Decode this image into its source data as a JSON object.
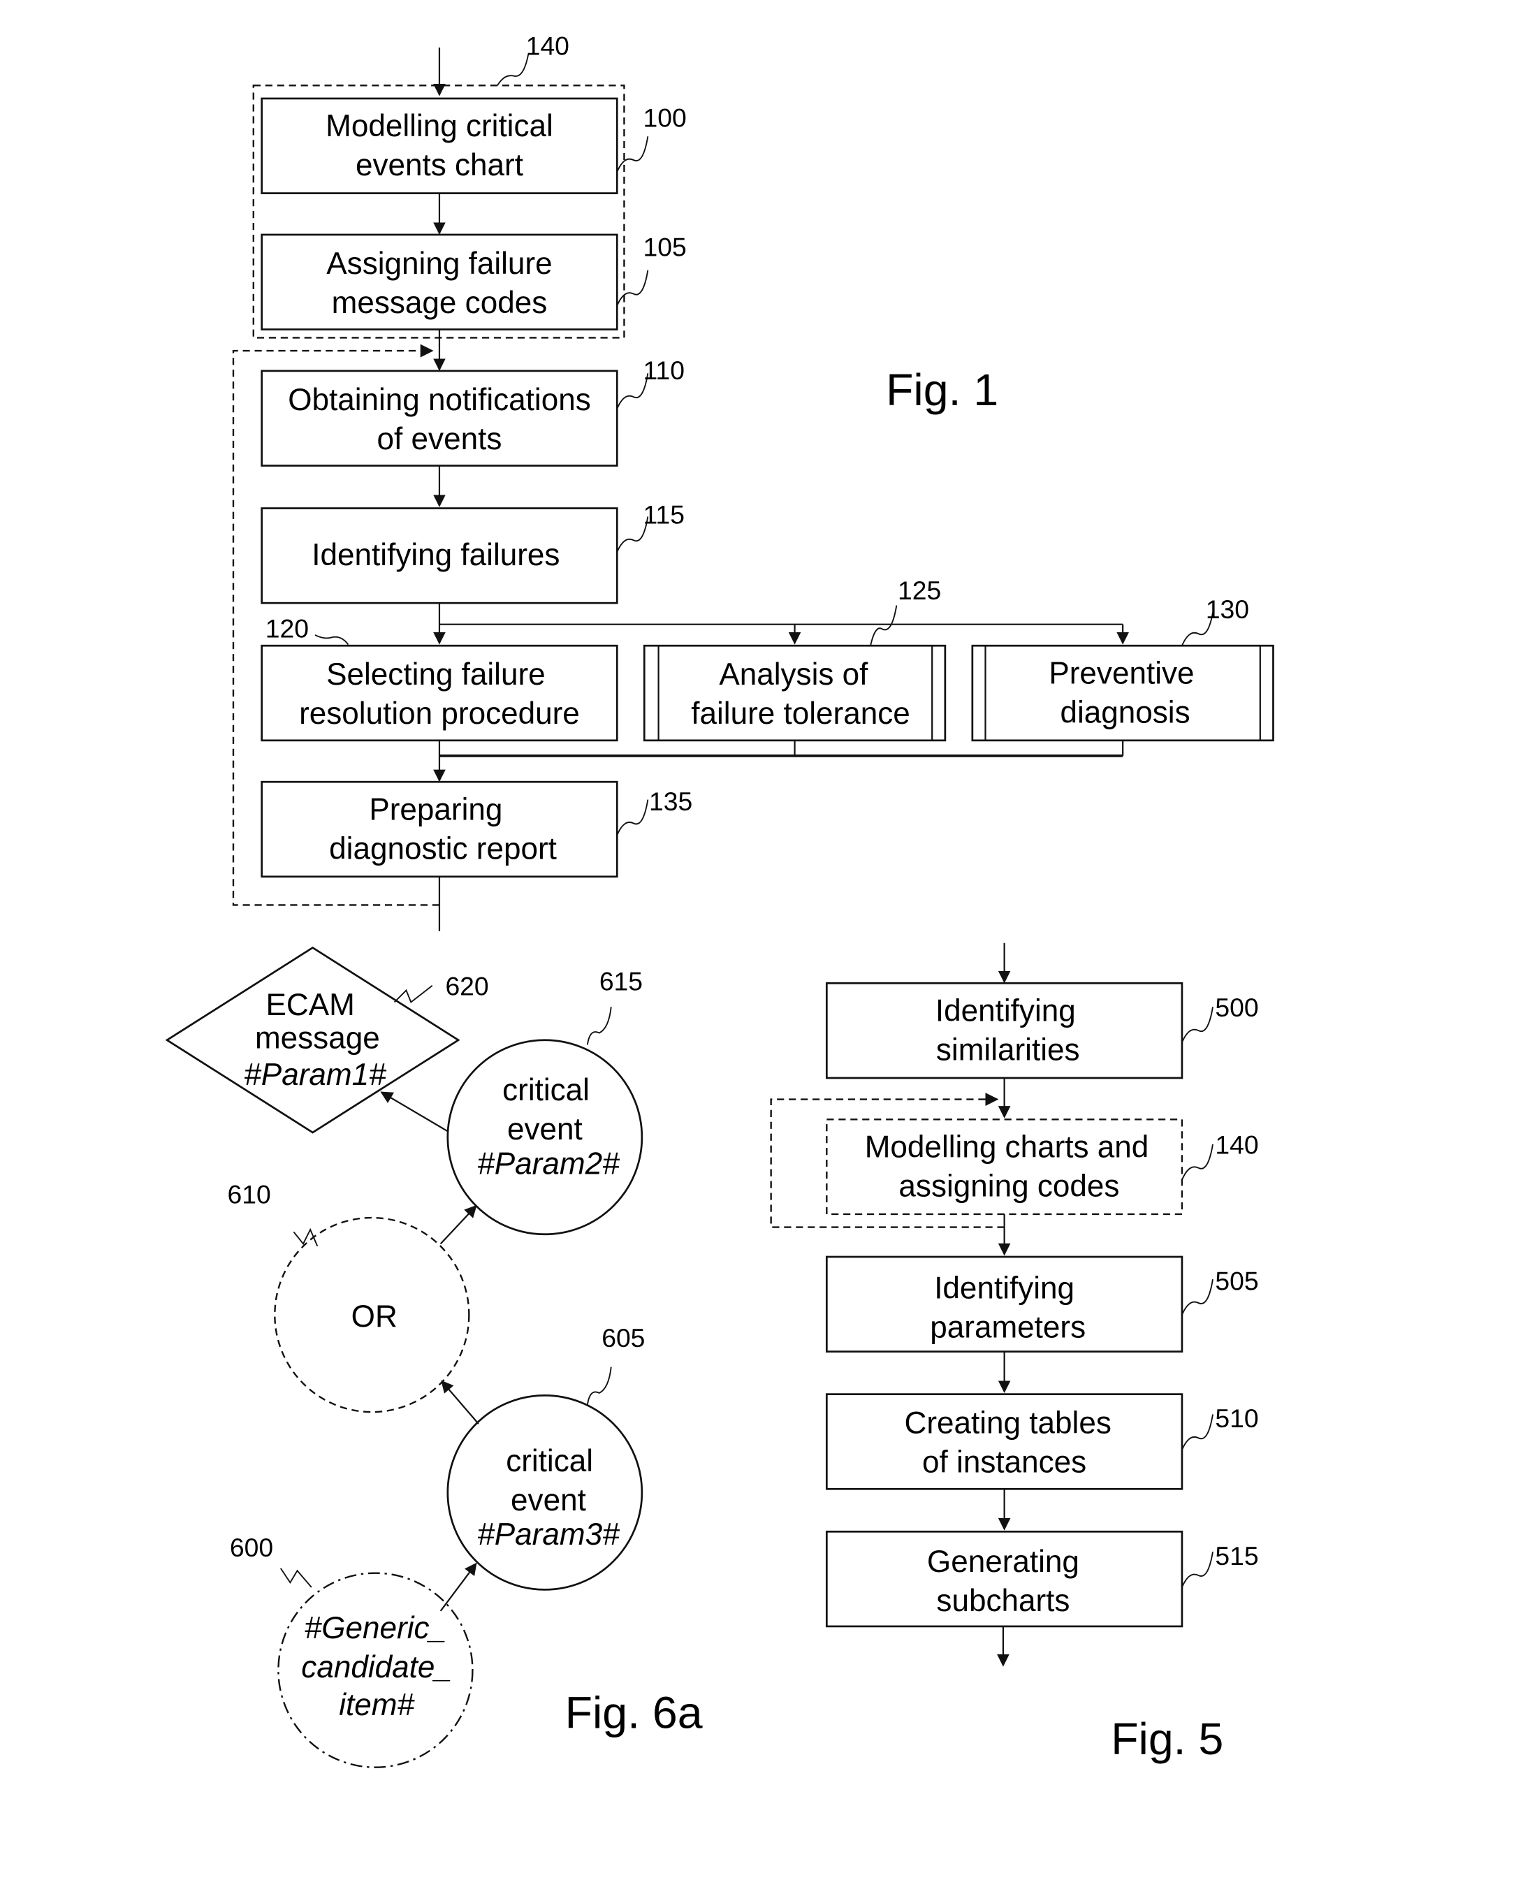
{
  "figures": {
    "fig1": {
      "title": "Fig. 1",
      "group": {
        "ref": "140"
      },
      "steps": [
        {
          "ref": "100",
          "lines": [
            "Modelling critical",
            "events chart"
          ]
        },
        {
          "ref": "105",
          "lines": [
            "Assigning failure",
            "message codes"
          ]
        },
        {
          "ref": "110",
          "lines": [
            "Obtaining notifications",
            "of events"
          ]
        },
        {
          "ref": "115",
          "lines": [
            "Identifying failures"
          ]
        },
        {
          "ref": "120",
          "lines": [
            "Selecting failure",
            "resolution procedure"
          ]
        },
        {
          "ref": "125",
          "lines": [
            "Analysis of",
            "failure tolerance"
          ]
        },
        {
          "ref": "130",
          "lines": [
            "Preventive",
            "diagnosis"
          ]
        },
        {
          "ref": "135",
          "lines": [
            "Preparing",
            "diagnostic report"
          ]
        }
      ]
    },
    "fig5": {
      "title": "Fig. 5",
      "steps": [
        {
          "ref": "500",
          "lines": [
            "Identifying",
            "similarities"
          ]
        },
        {
          "ref": "140",
          "lines": [
            "Modelling charts and",
            "assigning codes"
          ]
        },
        {
          "ref": "505",
          "lines": [
            "Identifying",
            "parameters"
          ]
        },
        {
          "ref": "510",
          "lines": [
            "Creating tables",
            "of instances"
          ]
        },
        {
          "ref": "515",
          "lines": [
            "Generating",
            "subcharts"
          ]
        }
      ]
    },
    "fig6a": {
      "title": "Fig. 6a",
      "nodes": {
        "ecam": {
          "ref": "620",
          "lines": [
            "ECAM",
            "message",
            "#Param1#"
          ]
        },
        "event2": {
          "ref": "615",
          "lines": [
            "critical",
            "event",
            "#Param2#"
          ]
        },
        "or": {
          "ref": "610",
          "lines": [
            "OR"
          ]
        },
        "event3": {
          "ref": "605",
          "lines": [
            "critical",
            "event",
            "#Param3#"
          ]
        },
        "generic": {
          "ref": "600",
          "lines": [
            "#Generic_",
            "candidate_",
            "item#"
          ]
        }
      }
    }
  }
}
